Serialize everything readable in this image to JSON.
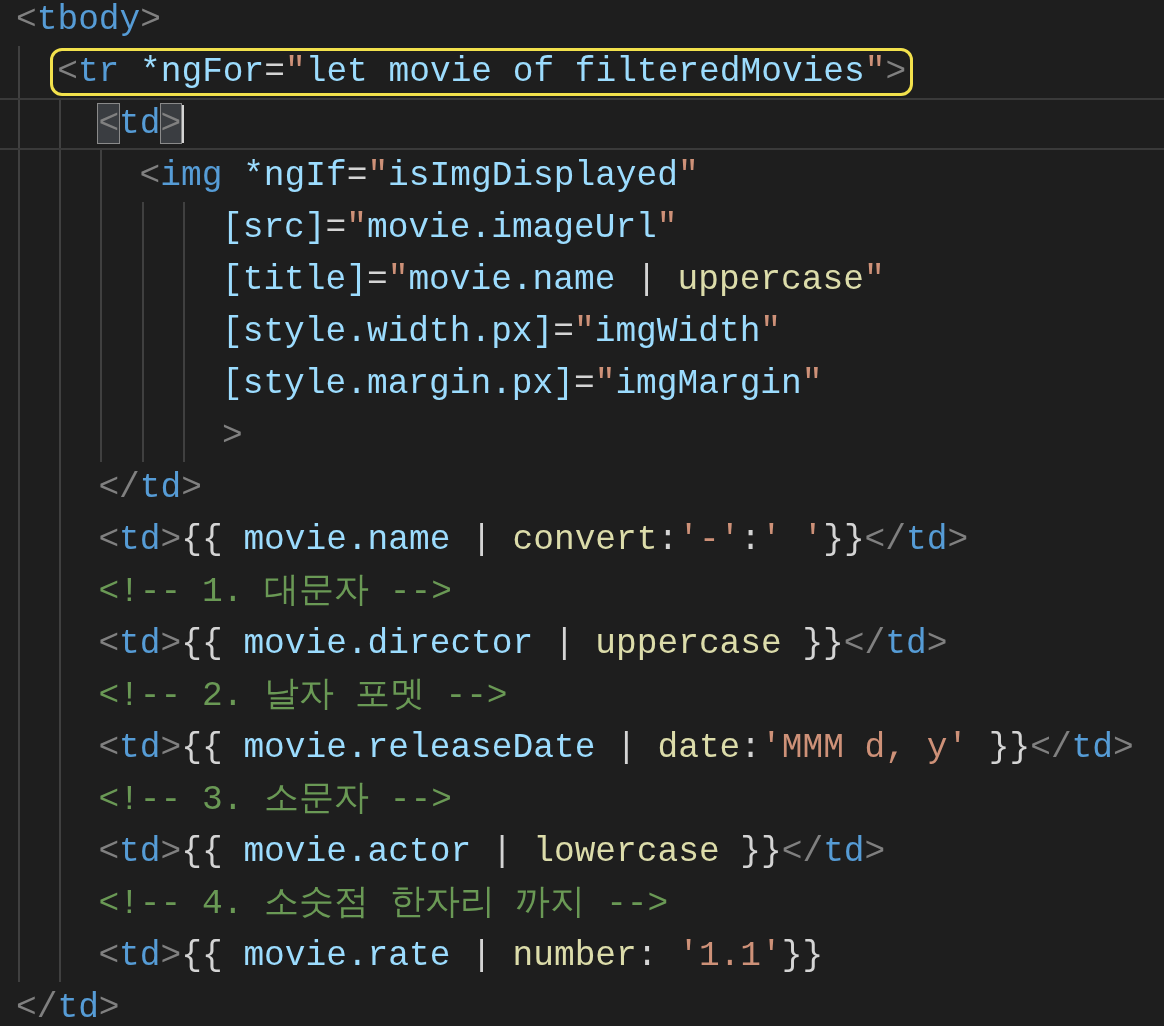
{
  "lines": [
    {
      "tokens": [
        {
          "kind": "bracket",
          "text": "<"
        },
        {
          "kind": "tag",
          "text": "tbody"
        },
        {
          "kind": "bracket",
          "text": ">"
        }
      ],
      "children": [
        {
          "highlighted": true,
          "tokens": [
            {
              "kind": "bracket",
              "text": "<"
            },
            {
              "kind": "tag",
              "text": "tr"
            },
            {
              "kind": "attr",
              "text": " *ngFor"
            },
            {
              "kind": "plain",
              "text": "="
            },
            {
              "kind": "string",
              "text": "\""
            },
            {
              "kind": "expr",
              "text": "let movie of filteredMovies"
            },
            {
              "kind": "string",
              "text": "\""
            },
            {
              "kind": "bracket",
              "text": ">"
            }
          ],
          "children": [
            {
              "current": true,
              "tokens": [
                {
                  "kind": "bracket",
                  "text": "<",
                  "matched": true
                },
                {
                  "kind": "tag",
                  "text": "td"
                },
                {
                  "kind": "bracket",
                  "text": ">",
                  "matched": true
                }
              ],
              "children": [
                {
                  "tokens": [
                    {
                      "kind": "bracket",
                      "text": "<"
                    },
                    {
                      "kind": "tag",
                      "text": "img"
                    },
                    {
                      "kind": "attr",
                      "text": " *ngIf"
                    },
                    {
                      "kind": "plain",
                      "text": "="
                    },
                    {
                      "kind": "string",
                      "text": "\""
                    },
                    {
                      "kind": "expr",
                      "text": "isImgDisplayed"
                    },
                    {
                      "kind": "string",
                      "text": "\""
                    }
                  ],
                  "children": [
                    {
                      "kind": "attribute",
                      "tokens": [
                        {
                          "kind": "attr",
                          "text": "[src]"
                        },
                        {
                          "kind": "plain",
                          "text": "="
                        },
                        {
                          "kind": "string",
                          "text": "\""
                        },
                        {
                          "kind": "expr",
                          "text": "movie.imageUrl"
                        },
                        {
                          "kind": "string",
                          "text": "\""
                        }
                      ]
                    },
                    {
                      "kind": "attribute",
                      "tokens": [
                        {
                          "kind": "attr",
                          "text": "[title]"
                        },
                        {
                          "kind": "plain",
                          "text": "="
                        },
                        {
                          "kind": "string",
                          "text": "\""
                        },
                        {
                          "kind": "expr",
                          "text": "movie.name"
                        },
                        {
                          "kind": "plain",
                          "text": " | "
                        },
                        {
                          "kind": "pipe",
                          "text": "uppercase"
                        },
                        {
                          "kind": "string",
                          "text": "\""
                        }
                      ]
                    },
                    {
                      "kind": "attribute",
                      "tokens": [
                        {
                          "kind": "attr",
                          "text": "[style.width.px]"
                        },
                        {
                          "kind": "plain",
                          "text": "="
                        },
                        {
                          "kind": "string",
                          "text": "\""
                        },
                        {
                          "kind": "expr",
                          "text": "imgWidth"
                        },
                        {
                          "kind": "string",
                          "text": "\""
                        }
                      ]
                    },
                    {
                      "kind": "attribute",
                      "tokens": [
                        {
                          "kind": "attr",
                          "text": "[style.margin.px]"
                        },
                        {
                          "kind": "plain",
                          "text": "="
                        },
                        {
                          "kind": "string",
                          "text": "\""
                        },
                        {
                          "kind": "expr",
                          "text": "imgMargin"
                        },
                        {
                          "kind": "string",
                          "text": "\""
                        }
                      ]
                    },
                    {
                      "kind": "attribute",
                      "tokens": [
                        {
                          "kind": "bracket",
                          "text": ">"
                        }
                      ]
                    }
                  ]
                }
              ]
            },
            {
              "tokens": [
                {
                  "kind": "bracket",
                  "text": "</"
                },
                {
                  "kind": "tag",
                  "text": "td"
                },
                {
                  "kind": "bracket",
                  "text": ">"
                }
              ]
            },
            {
              "tokens": [
                {
                  "kind": "bracket",
                  "text": "<"
                },
                {
                  "kind": "tag",
                  "text": "td"
                },
                {
                  "kind": "bracket",
                  "text": ">"
                },
                {
                  "kind": "plain",
                  "text": "{{ "
                },
                {
                  "kind": "expr",
                  "text": "movie.name"
                },
                {
                  "kind": "plain",
                  "text": " | "
                },
                {
                  "kind": "pipe",
                  "text": "convert"
                },
                {
                  "kind": "plain",
                  "text": ":"
                },
                {
                  "kind": "string",
                  "text": "'-'"
                },
                {
                  "kind": "plain",
                  "text": ":"
                },
                {
                  "kind": "string",
                  "text": "' '"
                },
                {
                  "kind": "plain",
                  "text": "}}"
                },
                {
                  "kind": "bracket",
                  "text": "</"
                },
                {
                  "kind": "tag",
                  "text": "td"
                },
                {
                  "kind": "bracket",
                  "text": ">"
                }
              ]
            },
            {
              "tokens": [
                {
                  "kind": "comment",
                  "text": "<!-- 1. 대문자 -->"
                }
              ]
            },
            {
              "tokens": [
                {
                  "kind": "bracket",
                  "text": "<"
                },
                {
                  "kind": "tag",
                  "text": "td"
                },
                {
                  "kind": "bracket",
                  "text": ">"
                },
                {
                  "kind": "plain",
                  "text": "{{ "
                },
                {
                  "kind": "expr",
                  "text": "movie.director"
                },
                {
                  "kind": "plain",
                  "text": " | "
                },
                {
                  "kind": "pipe",
                  "text": "uppercase"
                },
                {
                  "kind": "plain",
                  "text": " }}"
                },
                {
                  "kind": "bracket",
                  "text": "</"
                },
                {
                  "kind": "tag",
                  "text": "td"
                },
                {
                  "kind": "bracket",
                  "text": ">"
                }
              ]
            },
            {
              "tokens": [
                {
                  "kind": "comment",
                  "text": "<!-- 2. 날자 포멧 -->"
                }
              ]
            },
            {
              "tokens": [
                {
                  "kind": "bracket",
                  "text": "<"
                },
                {
                  "kind": "tag",
                  "text": "td"
                },
                {
                  "kind": "bracket",
                  "text": ">"
                },
                {
                  "kind": "plain",
                  "text": "{{ "
                },
                {
                  "kind": "expr",
                  "text": "movie.releaseDate"
                },
                {
                  "kind": "plain",
                  "text": " | "
                },
                {
                  "kind": "pipe",
                  "text": "date"
                },
                {
                  "kind": "plain",
                  "text": ":"
                },
                {
                  "kind": "string",
                  "text": "'MMM d, y'"
                },
                {
                  "kind": "plain",
                  "text": " }}"
                },
                {
                  "kind": "bracket",
                  "text": "</"
                },
                {
                  "kind": "tag",
                  "text": "td"
                },
                {
                  "kind": "bracket",
                  "text": ">"
                }
              ]
            },
            {
              "tokens": [
                {
                  "kind": "comment",
                  "text": "<!-- 3. 소문자 -->"
                }
              ]
            },
            {
              "tokens": [
                {
                  "kind": "bracket",
                  "text": "<"
                },
                {
                  "kind": "tag",
                  "text": "td"
                },
                {
                  "kind": "bracket",
                  "text": ">"
                },
                {
                  "kind": "plain",
                  "text": "{{ "
                },
                {
                  "kind": "expr",
                  "text": "movie.actor"
                },
                {
                  "kind": "plain",
                  "text": " | "
                },
                {
                  "kind": "pipe",
                  "text": "lowercase"
                },
                {
                  "kind": "plain",
                  "text": " }}"
                },
                {
                  "kind": "bracket",
                  "text": "</"
                },
                {
                  "kind": "tag",
                  "text": "td"
                },
                {
                  "kind": "bracket",
                  "text": ">"
                }
              ]
            },
            {
              "tokens": [
                {
                  "kind": "comment",
                  "text": "<!-- 4. 소숫점 한자리 까지 -->"
                }
              ]
            },
            {
              "tokens": [
                {
                  "kind": "bracket",
                  "text": "<"
                },
                {
                  "kind": "tag",
                  "text": "td"
                },
                {
                  "kind": "bracket",
                  "text": ">"
                },
                {
                  "kind": "plain",
                  "text": "{{ "
                },
                {
                  "kind": "expr",
                  "text": "movie.rate"
                },
                {
                  "kind": "plain",
                  "text": " | "
                },
                {
                  "kind": "pipe",
                  "text": "number"
                },
                {
                  "kind": "plain",
                  "text": ": "
                },
                {
                  "kind": "string",
                  "text": "'1.1'"
                },
                {
                  "kind": "plain",
                  "text": "}}"
                }
              ]
            }
          ]
        }
      ]
    },
    {
      "tokens": [
        {
          "kind": "bracket",
          "text": "</"
        },
        {
          "kind": "tag",
          "text": "td"
        },
        {
          "kind": "bracket",
          "text": ">"
        }
      ]
    }
  ]
}
